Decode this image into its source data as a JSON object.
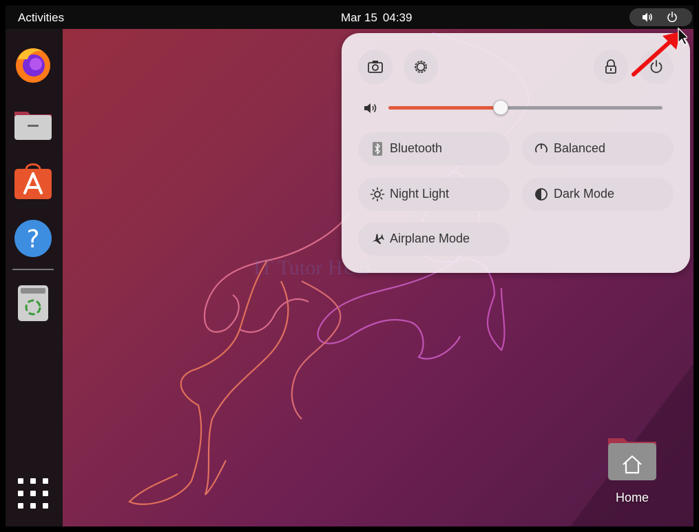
{
  "topbar": {
    "activities_label": "Activities",
    "date": "Mar 15",
    "time": "04:39",
    "status_icons": [
      "volume-icon",
      "power-icon"
    ]
  },
  "dock": {
    "items": [
      {
        "name": "firefox",
        "icon": "firefox-icon"
      },
      {
        "name": "files",
        "icon": "files-icon"
      },
      {
        "name": "software",
        "icon": "software-store-icon"
      },
      {
        "name": "help",
        "icon": "help-icon"
      },
      {
        "name": "trash",
        "icon": "trash-icon"
      }
    ],
    "show_apps_icon": "app-grid-icon"
  },
  "quick_settings": {
    "buttons": [
      "screenshot-icon",
      "settings-icon",
      "lock-icon",
      "power-icon"
    ],
    "volume_level": 0.41,
    "toggles": [
      {
        "label": "Bluetooth",
        "icon": "bluetooth-icon"
      },
      {
        "label": "Balanced",
        "icon": "power-profile-icon"
      },
      {
        "label": "Night Light",
        "icon": "night-light-icon"
      },
      {
        "label": "Dark Mode",
        "icon": "dark-mode-icon"
      },
      {
        "label": "Airplane Mode",
        "icon": "airplane-icon"
      }
    ]
  },
  "desktop": {
    "home_label": "Home"
  },
  "colors": {
    "accent": "#e05b3c",
    "annotation_arrow": "#ee1111",
    "topbar": "#0d0d0d",
    "dock": "#1c1418"
  }
}
